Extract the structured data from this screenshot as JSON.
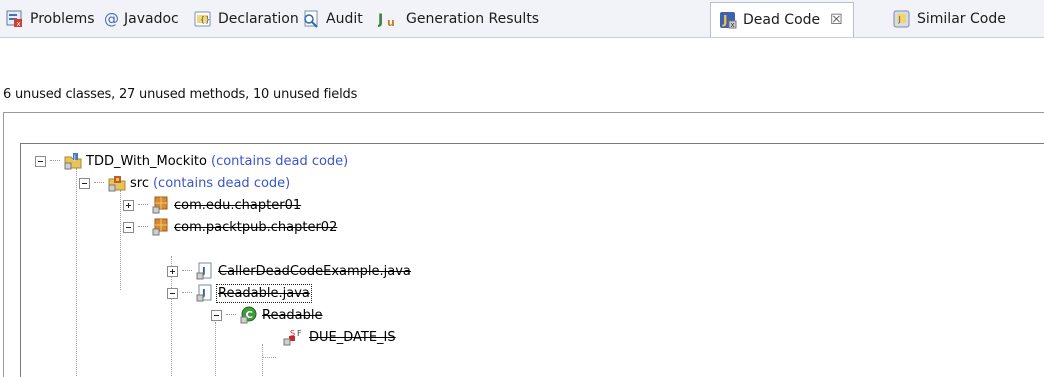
{
  "tabs": [
    {
      "label": "Problems",
      "icon": "problems-icon"
    },
    {
      "label": "Javadoc",
      "icon": "javadoc-icon"
    },
    {
      "label": "Declaration",
      "icon": "declaration-icon"
    },
    {
      "label": "Audit",
      "icon": "audit-icon"
    },
    {
      "label": "Generation Results",
      "icon": "junit-icon"
    },
    {
      "label": "Dead Code",
      "icon": "dead-code-icon",
      "active": true
    },
    {
      "label": "Similar Code",
      "icon": "similar-code-icon"
    }
  ],
  "summary": "6 unused classes, 27 unused methods, 10 unused fields",
  "tree": {
    "project": {
      "name": "TDD_With_Mockito",
      "note": "(contains dead code)"
    },
    "src": {
      "name": "src",
      "note": "(contains dead code)"
    },
    "packages": [
      {
        "name": "com.edu.chapter01",
        "expanded": false
      },
      {
        "name": "com.packtpub.chapter02",
        "expanded": true
      }
    ],
    "files": [
      {
        "name": "CallerDeadCodeExample.java",
        "expanded": false
      },
      {
        "name": "Readable.java",
        "expanded": true,
        "selected": true
      }
    ],
    "class": {
      "name": "Readable"
    },
    "field": {
      "name": "DUE_DATE_IS",
      "modifiers": "S F"
    }
  },
  "colors": {
    "accent_link": "#3a55c9",
    "tab_bar": "#f1f3f8"
  }
}
